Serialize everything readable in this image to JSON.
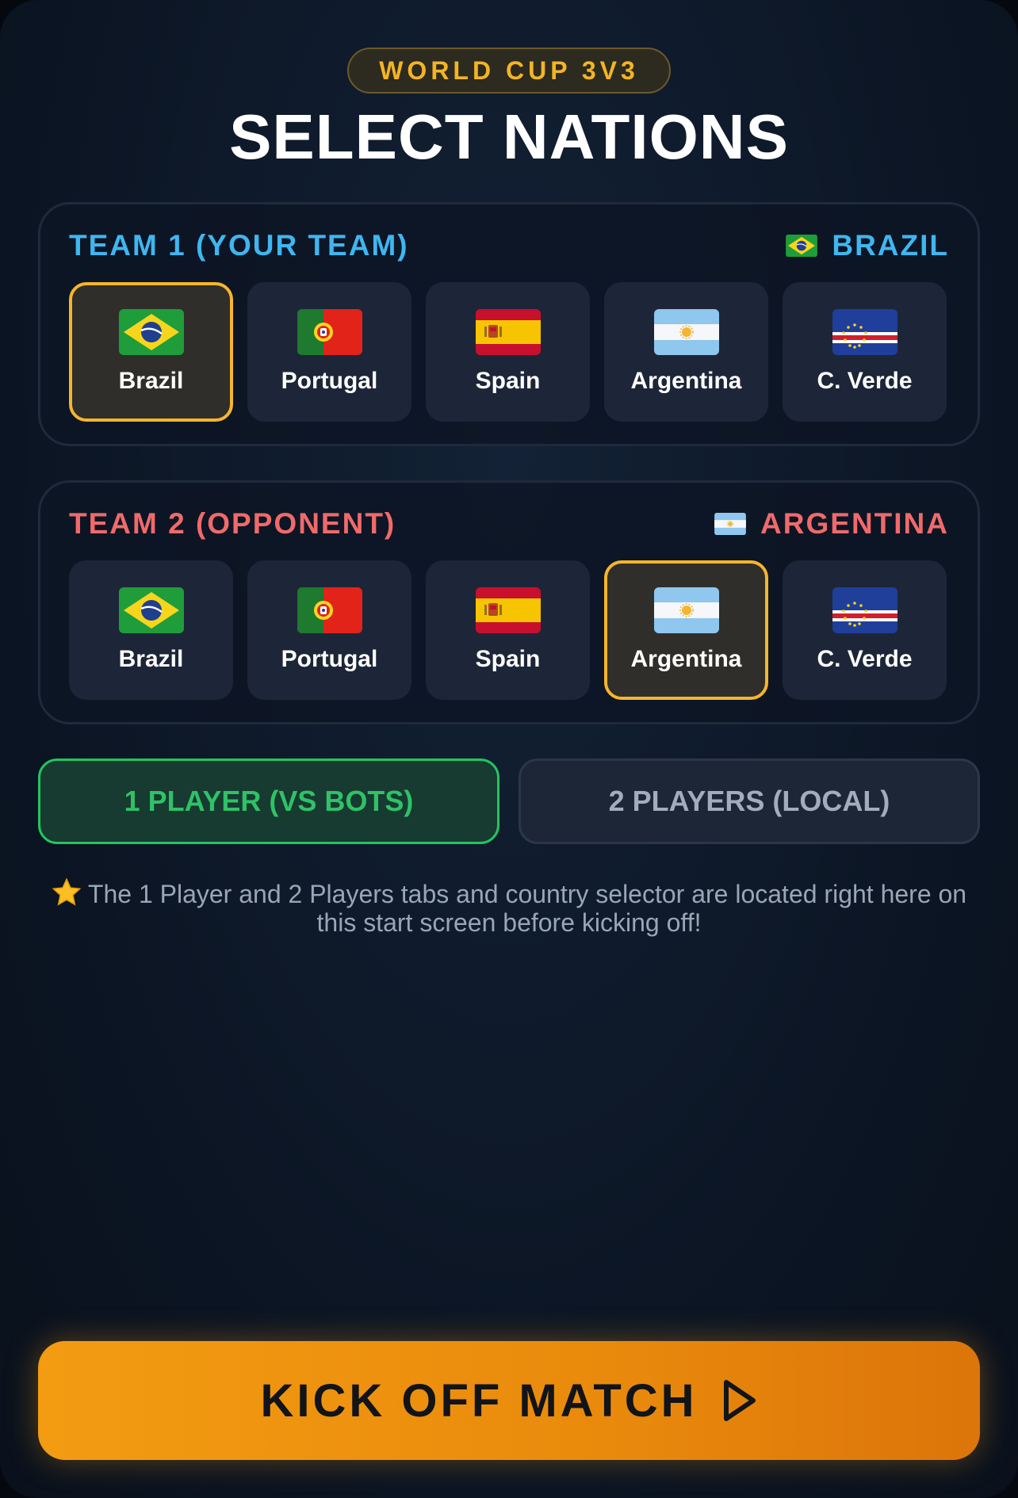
{
  "header": {
    "badge": "WORLD CUP 3V3",
    "title": "SELECT NATIONS"
  },
  "team1": {
    "label": "TEAM 1 (YOUR TEAM)",
    "selected_label": "BRAZIL",
    "selected_flag_icon": "brazil-flag-icon",
    "accent_color": "#3fb6f0",
    "nations": [
      {
        "name": "Brazil",
        "icon": "brazil-flag-icon",
        "selected": true
      },
      {
        "name": "Portugal",
        "icon": "portugal-flag-icon",
        "selected": false
      },
      {
        "name": "Spain",
        "icon": "spain-flag-icon",
        "selected": false
      },
      {
        "name": "Argentina",
        "icon": "argentina-flag-icon",
        "selected": false
      },
      {
        "name": "C. Verde",
        "icon": "cape-verde-flag-icon",
        "selected": false
      }
    ]
  },
  "team2": {
    "label": "TEAM 2 (OPPONENT)",
    "selected_label": "ARGENTINA",
    "selected_flag_icon": "argentina-flag-icon",
    "accent_color": "#f06a6a",
    "nations": [
      {
        "name": "Brazil",
        "icon": "brazil-flag-icon",
        "selected": false
      },
      {
        "name": "Portugal",
        "icon": "portugal-flag-icon",
        "selected": false
      },
      {
        "name": "Spain",
        "icon": "spain-flag-icon",
        "selected": false
      },
      {
        "name": "Argentina",
        "icon": "argentina-flag-icon",
        "selected": true
      },
      {
        "name": "C. Verde",
        "icon": "cape-verde-flag-icon",
        "selected": false
      }
    ]
  },
  "modes": {
    "one_player": {
      "label": "1 PLAYER (VS BOTS)",
      "active": true
    },
    "two_players": {
      "label": "2 PLAYERS (LOCAL)",
      "active": false
    }
  },
  "hint": {
    "icon": "star-icon",
    "text": "The 1 Player and 2 Players tabs and country selector are located right here on this start screen before kicking off!"
  },
  "kickoff": {
    "label": "KICK OFF MATCH",
    "icon": "play-icon"
  },
  "colors": {
    "selection_border": "#f7b52c",
    "active_mode": "#22c55e",
    "kickoff_button": "#f39c12"
  }
}
